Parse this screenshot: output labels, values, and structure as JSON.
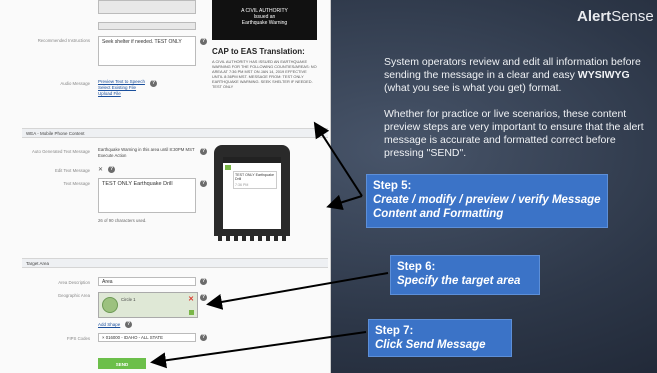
{
  "screenshot": {
    "recommended_instructions_label": "Recommended Instructions",
    "recommended_instructions_value": "Seek shelter if needed. TEST ONLY",
    "black_box_text": [
      "A CIVIL AUTHORITY",
      "Issued an",
      "Earthquake Warning"
    ],
    "eas_title": "CAP to EAS Translation:",
    "eas_body": "A CIVIL AUTHORITY HAS ISSUED AN EARTHQUAKE WARNING FOR THE FOLLOWING COUNTIES/AREAS: NO AREA AT 7:36 PM MST ON JAN 14, 2019 EFFECTIVE UNTIL 8:36PM MST. Message from: TEST ONLY EARTHQUAKE WARNING. SEEK SHELTER IF NEEDED. TEST ONLY",
    "audio_message_label": "Audio Message",
    "audio_links": [
      "Preview Text to Speech",
      "Select Existing File",
      "Upload File"
    ],
    "wea_section": "WEA - Mobile Phone Content",
    "auto_text_label": "Auto Generated Text Message",
    "auto_text_value": "Earthquake Warning in this area until 8:30PM MST Execute Action",
    "edit_text_label": "Edit Text Message",
    "edit_text_checkbox": "✕",
    "text_message_label": "Text Message",
    "text_message_value": "TEST ONLY Earthquake Drill",
    "chars_used": "26 of 90 characters used.",
    "phone_bubble": "TEST ONLY Earthquake Drill",
    "phone_time": "7:36 PM",
    "target_section": "Target Area",
    "area_desc_label": "Area Description",
    "area_desc_value": "Area",
    "geo_area_label": "Geographic Area",
    "geo_item": "Circle 1",
    "add_shape": "Add Shape",
    "fips_label": "FIPS Codes",
    "fips_value": "× 016000 - IDAHO - ALL STATE",
    "send_button": "SEND MESSAGE"
  },
  "logo": {
    "bold": "Alert",
    "rest": "Sense"
  },
  "intro": {
    "p1_before": "System operators review and edit all information before sending the message in a clear and easy ",
    "p1_bold": "WYSIWYG",
    "p1_after": " (what you see is what you get)  format.",
    "p2": "Whether for practice or live scenarios, these content preview steps are very important to ensure that the alert message is accurate and formatted correct before pressing \"SEND\"."
  },
  "steps": [
    {
      "title": "Step 5:",
      "text": "Create / modify / preview / verify Message Content and Formatting"
    },
    {
      "title": "Step 6:",
      "text": "Specify the target area"
    },
    {
      "title": "Step 7:",
      "text": "Click Send Message"
    }
  ],
  "colors": {
    "step_box": "#3b73c7",
    "send_button": "#6cbf4a",
    "background": "#2d3748"
  }
}
